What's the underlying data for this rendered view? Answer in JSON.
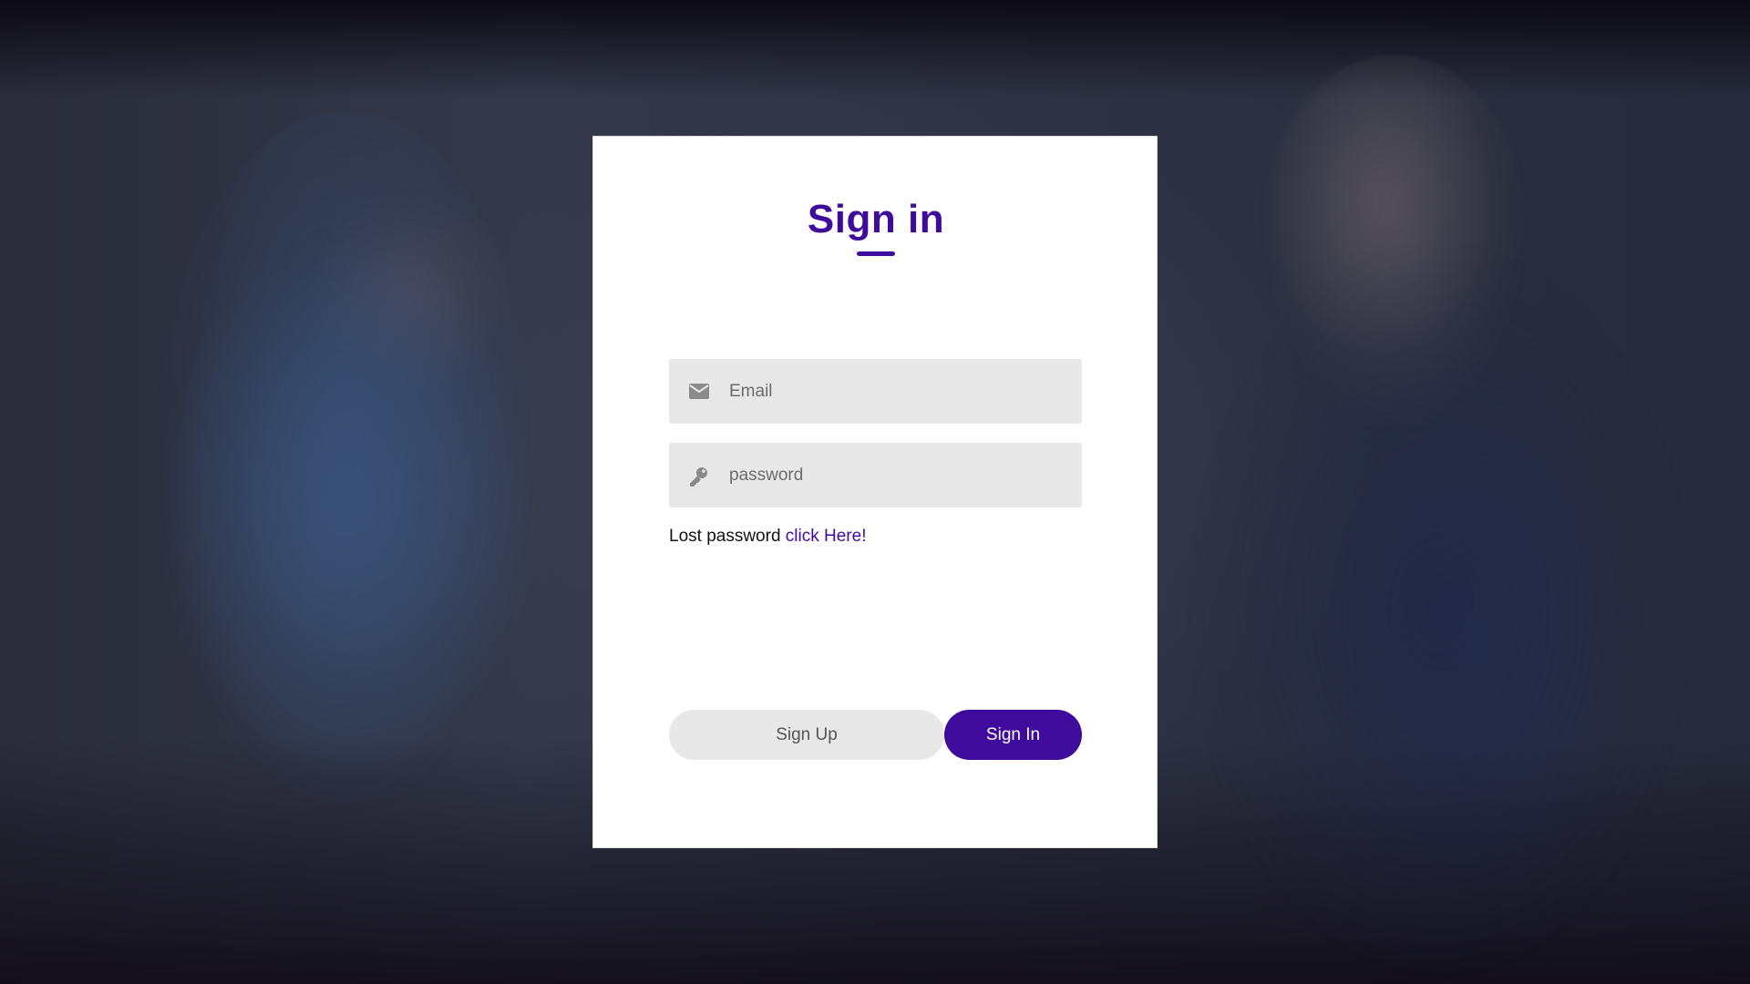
{
  "background": {
    "description_icon": "photo-background"
  },
  "card": {
    "title": "Sign in",
    "accent_color": "#3f0b9c",
    "email": {
      "placeholder": "Email",
      "value": "",
      "icon": "envelope-icon"
    },
    "password": {
      "placeholder": "password",
      "value": "",
      "icon": "key-icon"
    },
    "lost_password": {
      "text": "Lost password",
      "link_text": "click Here!"
    },
    "buttons": {
      "sign_up": "Sign Up",
      "sign_in": "Sign In"
    }
  }
}
